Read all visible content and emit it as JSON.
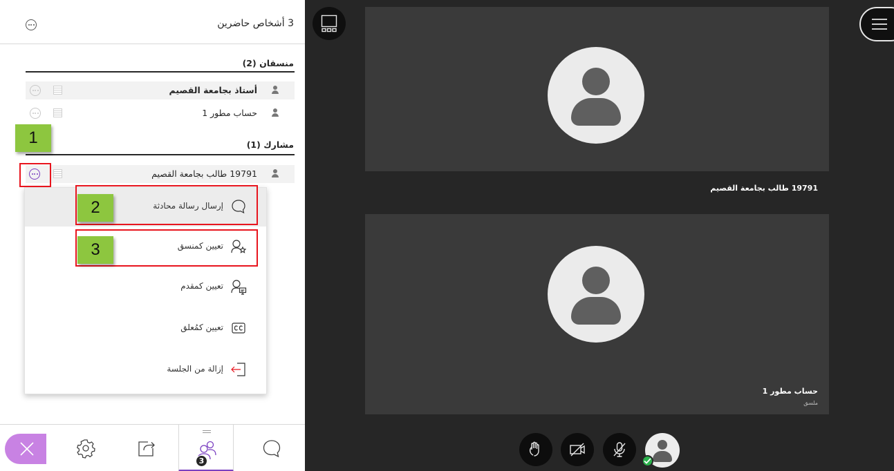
{
  "panel": {
    "title": "3 أشخاص حاضرين",
    "moderators": {
      "heading": "منسقان (2)",
      "items": [
        {
          "name": "أستاذ بجامعة القصيم",
          "bold": true
        },
        {
          "name": "حساب مطور 1",
          "bold": false
        }
      ]
    },
    "participants": {
      "heading": "مشارك (1)",
      "items": [
        {
          "name": "19791 طالب بجامعة القصيم"
        }
      ]
    },
    "context_menu": {
      "items": [
        {
          "label": "إرسال رسالة محادثة",
          "icon": "chat-bubble-icon"
        },
        {
          "label": "تعيين كمنسق",
          "icon": "make-moderator-icon"
        },
        {
          "label": "تعيين كمقدم",
          "icon": "make-presenter-icon"
        },
        {
          "label": "تعيين كمُعلق",
          "icon": "closed-captions-icon"
        },
        {
          "label": "إزالة من الجلسة",
          "icon": "remove-from-session-icon"
        }
      ]
    },
    "toolbar": {
      "items": [
        "close-panel-icon",
        "settings-gear-icon",
        "share-content-icon",
        "attendees-icon",
        "chat-icon"
      ],
      "attendee_badge": "3"
    }
  },
  "annotations": [
    "1",
    "2",
    "3"
  ],
  "stage": {
    "tiles": [
      {
        "name": "19791 طالب بجامعة القصيم",
        "role": ""
      },
      {
        "name": "حساب مطور 1",
        "role": "ملسق"
      }
    ],
    "controls": [
      "raise-hand-icon",
      "camera-off-icon",
      "microphone-muted-icon",
      "my-status-avatar"
    ]
  },
  "colors": {
    "accent_purple": "#7a3fc0",
    "close_button": "#c882e3",
    "callout_green": "#8dc63f",
    "highlight_red": "#e8141d",
    "stage_background": "#262626",
    "tile_background": "#3a3a3a",
    "status_green": "#2bb24c"
  }
}
